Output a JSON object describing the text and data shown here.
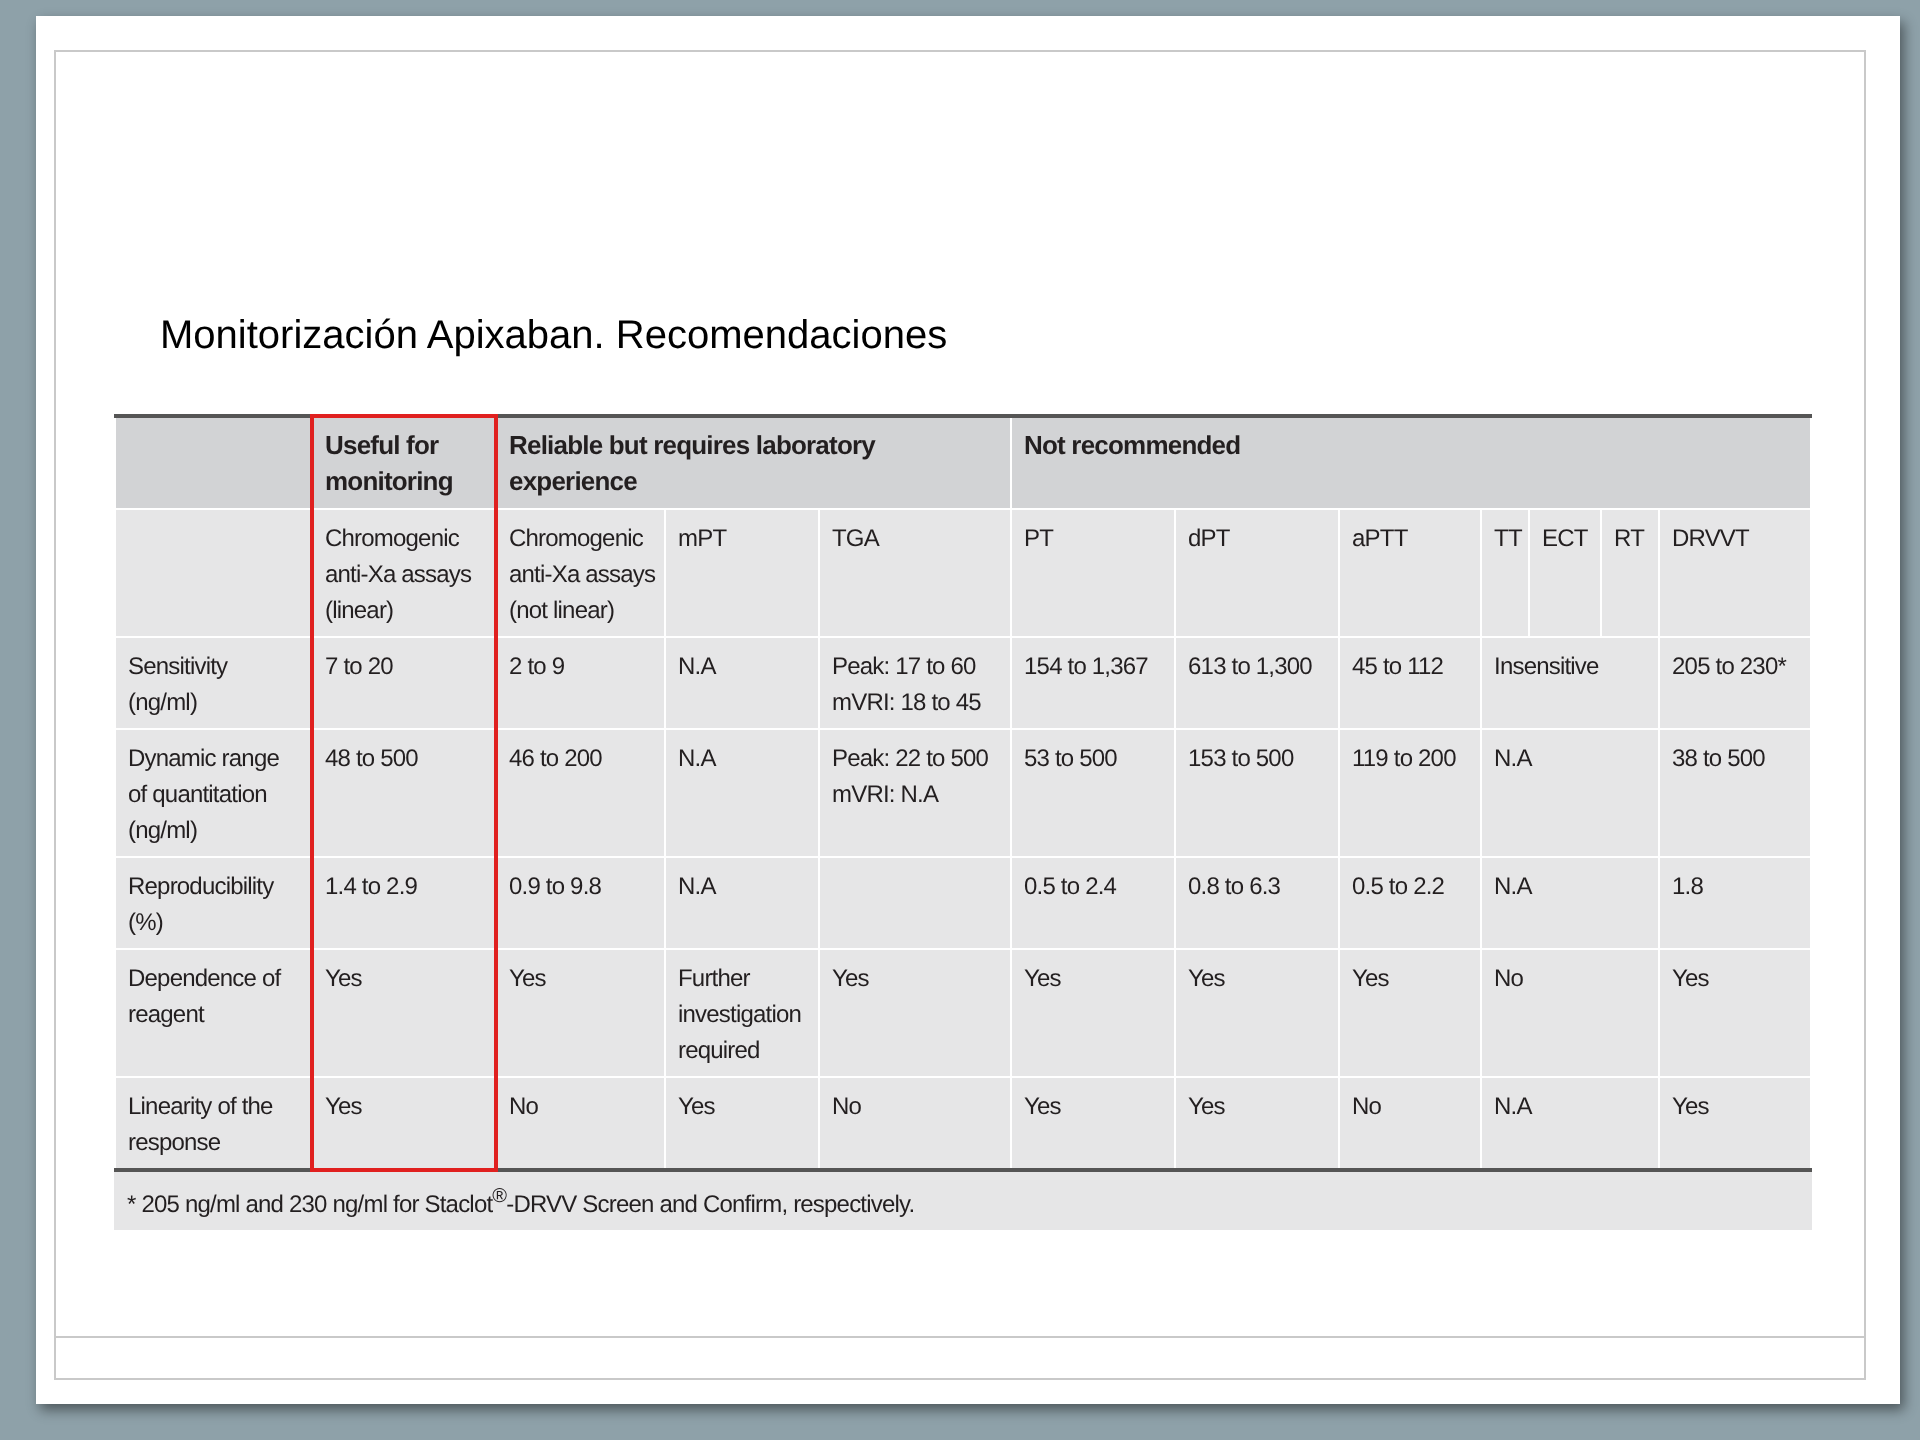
{
  "slide": {
    "title": "Monitorización Apixaban. Recomendaciones"
  },
  "table": {
    "groups": [
      {
        "label": "Useful for monitoring",
        "kind": "single",
        "highlighted": true
      },
      {
        "label": "Reliable but requires laboratory experience",
        "kind": "triple",
        "highlighted": false
      },
      {
        "label": "Not recommended",
        "kind": "septuple",
        "highlighted": false
      }
    ],
    "columns": [
      "Chromogenic anti-Xa assays (linear)",
      "Chromogenic anti-Xa assays (not linear)",
      "mPT",
      "TGA",
      "PT",
      "dPT",
      "aPTT",
      "TT",
      "ECT",
      "RT",
      "DRVVT"
    ],
    "rows": [
      {
        "label": "Sensitivity (ng/ml)",
        "cells": [
          {
            "text": "7 to 20"
          },
          {
            "text": "2 to 9"
          },
          {
            "text": "N.A"
          },
          {
            "text": "Peak: 17 to 60 mVRI: 18 to 45"
          },
          {
            "text": "154 to 1,367"
          },
          {
            "text": "613 to 1,300"
          },
          {
            "text": "45 to 112"
          },
          {
            "text": "Insensitive",
            "colspan": 3
          },
          {
            "text": "205 to 230*"
          }
        ]
      },
      {
        "label": "Dynamic range of quantitation (ng/ml)",
        "cells": [
          {
            "text": "48 to 500"
          },
          {
            "text": "46 to 200"
          },
          {
            "text": "N.A"
          },
          {
            "text": "Peak: 22 to 500 mVRI: N.A"
          },
          {
            "text": "53 to 500"
          },
          {
            "text": "153 to 500"
          },
          {
            "text": "119 to 200"
          },
          {
            "text": "N.A",
            "colspan": 3
          },
          {
            "text": "38 to 500"
          }
        ]
      },
      {
        "label": "Reproducibility (%)",
        "cells": [
          {
            "text": "1.4 to 2.9"
          },
          {
            "text": "0.9 to 9.8"
          },
          {
            "text": "N.A"
          },
          {
            "text": ""
          },
          {
            "text": "0.5 to 2.4"
          },
          {
            "text": "0.8 to 6.3"
          },
          {
            "text": "0.5 to 2.2"
          },
          {
            "text": "N.A",
            "colspan": 3
          },
          {
            "text": "1.8"
          }
        ]
      },
      {
        "label": "Dependence of reagent",
        "cells": [
          {
            "text": "Yes"
          },
          {
            "text": "Yes"
          },
          {
            "text": "Further investigation required"
          },
          {
            "text": "Yes"
          },
          {
            "text": "Yes"
          },
          {
            "text": "Yes"
          },
          {
            "text": "Yes"
          },
          {
            "text": "No",
            "colspan": 3
          },
          {
            "text": "Yes"
          }
        ]
      },
      {
        "label": "Linearity of the response",
        "cells": [
          {
            "text": "Yes"
          },
          {
            "text": "No"
          },
          {
            "text": "Yes"
          },
          {
            "text": "No"
          },
          {
            "text": "Yes"
          },
          {
            "text": "Yes"
          },
          {
            "text": "No"
          },
          {
            "text": "N.A",
            "colspan": 3
          },
          {
            "text": "Yes"
          }
        ]
      }
    ],
    "footnote": "* 205 ng/ml and 230 ng/ml for Staclot$^{®}$-DRVV Screen and Confirm, respectively."
  }
}
